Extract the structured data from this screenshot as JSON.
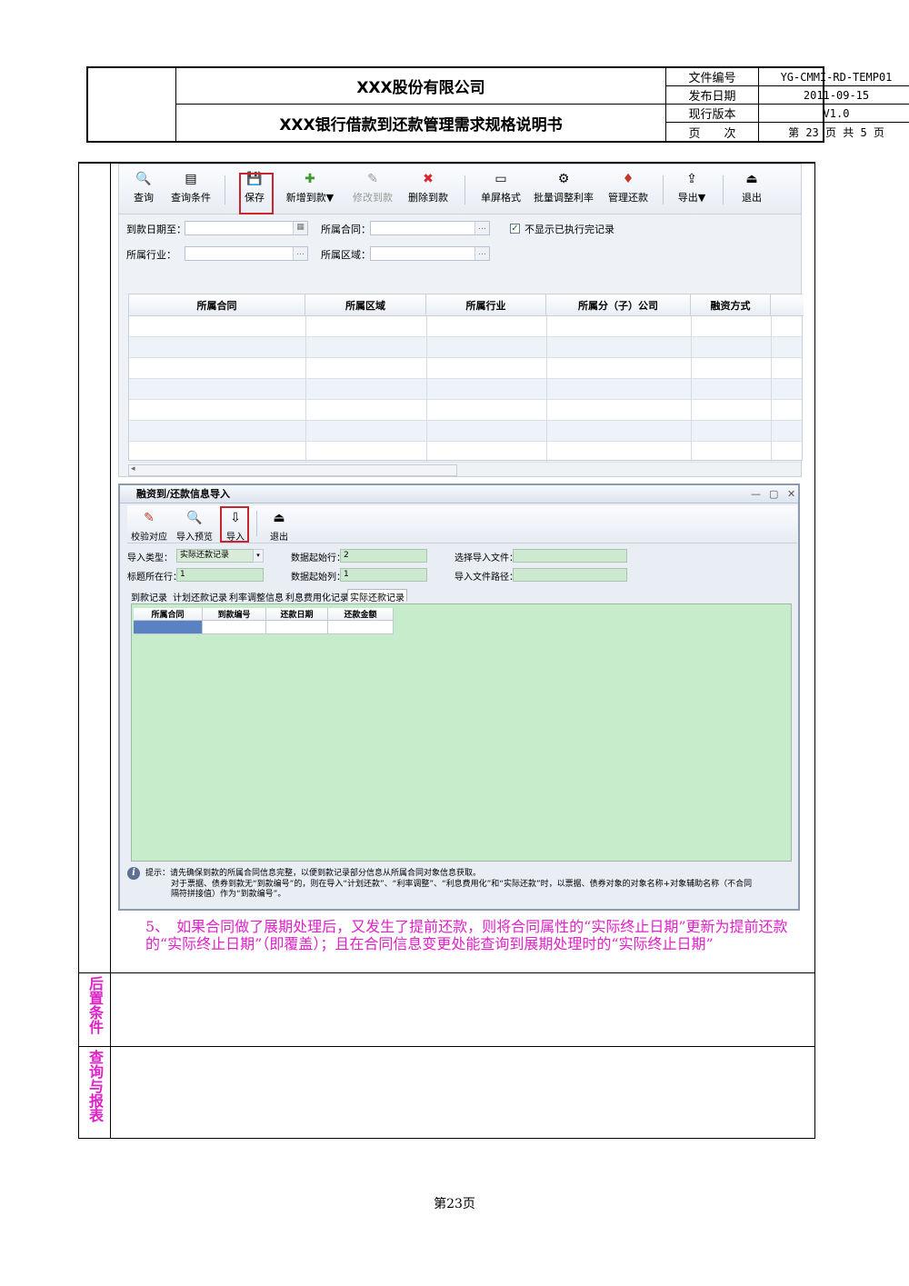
{
  "header": {
    "company": "XXX股份有限公司",
    "doc_title": "XXX银行借款到还款管理需求规格说明书",
    "meta": [
      {
        "label": "文件编号",
        "value": "YG-CMMI-RD-TEMP01"
      },
      {
        "label": "发布日期",
        "value": "2011-09-15"
      },
      {
        "label": "现行版本",
        "value": "V1.0"
      },
      {
        "label": "页　　次",
        "value": "第 23 页 共 5 页"
      }
    ]
  },
  "screen1": {
    "toolbar": [
      {
        "label": "查询",
        "icon": "search-icon",
        "glyph": "🔍"
      },
      {
        "label": "查询条件",
        "icon": "query-conditions-icon",
        "glyph": "▤"
      },
      {
        "label": "保存",
        "icon": "save-icon",
        "glyph": "💾"
      },
      {
        "label": "新增到款▼",
        "icon": "add-icon",
        "glyph": "✚"
      },
      {
        "label": "修改到款",
        "icon": "edit-icon",
        "glyph": "✎"
      },
      {
        "label": "删除到款",
        "icon": "delete-icon",
        "glyph": "✖"
      },
      {
        "label": "单屏格式",
        "icon": "single-screen-icon",
        "glyph": "▭"
      },
      {
        "label": "批量调整利率",
        "icon": "batch-rate-icon",
        "glyph": "⚙"
      },
      {
        "label": "管理还款",
        "icon": "manage-repay-icon",
        "glyph": "♦"
      },
      {
        "label": "导出▼",
        "icon": "export-icon",
        "glyph": "⇪"
      },
      {
        "label": "退出",
        "icon": "exit-icon",
        "glyph": "⏏"
      }
    ],
    "form": {
      "arrival_date_label": "到款日期至：",
      "contract_label": "所属合同：",
      "industry_label": "所属行业：",
      "region_label": "所属区域：",
      "hide_done_label": "不显示已执行完记录",
      "hide_done_checked": "✓"
    },
    "columns": [
      "所属合同",
      "所属区域",
      "所属行业",
      "所属分（子）公司",
      "融资方式"
    ]
  },
  "screen2": {
    "title": "融资到/还款信息导入",
    "window_controls": [
      "—",
      "▢",
      "✕"
    ],
    "toolbar": [
      {
        "label": "校验对应",
        "icon": "verify-icon",
        "glyph": "✎"
      },
      {
        "label": "导入预览",
        "icon": "preview-icon",
        "glyph": "🔍"
      },
      {
        "label": "导入",
        "icon": "import-icon",
        "glyph": "⇩"
      },
      {
        "label": "退出",
        "icon": "exit-icon",
        "glyph": "⏏"
      }
    ],
    "form": {
      "import_type_label": "导入类型：",
      "import_type_value": "实际还款记录",
      "start_row_label": "数据起始行：",
      "start_row_value": "2",
      "file_label": "选择导入文件：",
      "header_row_label": "标题所在行：",
      "header_row_value": "1",
      "start_col_label": "数据起始列：",
      "start_col_value": "1",
      "path_label": "导入文件路径："
    },
    "tabs": [
      "到款记录",
      "计划还款记录",
      "利率调整信息",
      "利息费用化记录",
      "实际还款记录"
    ],
    "columns": [
      "所属合同",
      "到款编号",
      "还款日期",
      "还款金额"
    ],
    "tip_label": "提示：",
    "tip_line1": "请先确保到款的所属合同信息完整，以便到款记录部分信息从所属合同对象信息获取。",
    "tip_line2": "对于票据、债券到款无“到款编号”的，则在导入“计划还款”、“利率调整”、“利息费用化”和“实际还款”时，以票据、债券对象的对象名称+对象辅助名称（不合同",
    "tip_line3": "隔符拼接值）作为“到款编号”。"
  },
  "note_text": "5、　如果合同做了展期处理后，又发生了提前还款，则将合同属性的“实际终止日期”更新为提前还款的“实际终止日期”（即覆盖）；且在合同信息变更处能查询到展期处理时的“实际终止日期”",
  "side_labels": {
    "post_condition": "后置条件",
    "query_report": "查询与报表"
  },
  "footer": "第23页"
}
